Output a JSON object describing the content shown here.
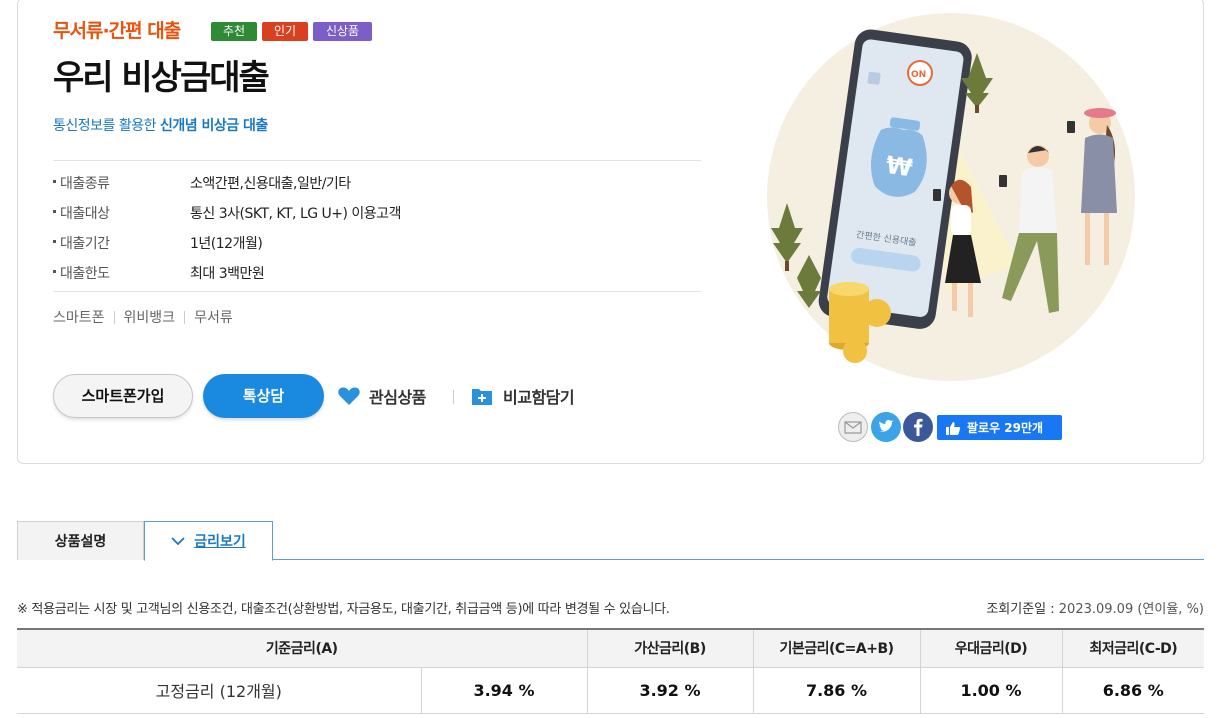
{
  "product": {
    "category": "무서류·간편 대출",
    "badges": [
      "추천",
      "인기",
      "신상품"
    ],
    "title": "우리 비상금대출",
    "subtitle_plain": "통신정보를 활용한 ",
    "subtitle_bold": "신개념 비상금 대출",
    "specs": [
      {
        "label": "대출종류",
        "value": "소액간편,신용대출,일반/기타"
      },
      {
        "label": "대출대상",
        "value": "통신 3사(SKT, KT, LG U+) 이용고객"
      },
      {
        "label": "대출기간",
        "value": "1년(12개월)"
      },
      {
        "label": "대출한도",
        "value": "최대 3백만원"
      }
    ],
    "tags": [
      "스마트폰",
      "위비뱅크",
      "무서류"
    ]
  },
  "actions": {
    "smartphone_join": "스마트폰가입",
    "talk": "톡상담",
    "interest": "관심상품",
    "compare": "비교함담기"
  },
  "illustration": {
    "phone_on_label": "ON",
    "phone_text": "간편한 신용대출"
  },
  "social": {
    "follow_label": "팔로우 29만개"
  },
  "tabs": {
    "description": "상품설명",
    "rates": "금리보기"
  },
  "rates": {
    "note": "※ 적용금리는 시장 및 고객님의 신용조건, 대출조건(상환방법, 자금용도, 대출기간, 취급금액 등)에 따라 변경될 수 있습니다.",
    "base_date_label": "조회기준일 : ",
    "base_date_value": "2023.09.09 (연이율, %)",
    "headers": [
      "기준금리(A)",
      "가산금리(B)",
      "기본금리(C=A+B)",
      "우대금리(D)",
      "최저금리(C-D)"
    ],
    "row": {
      "label": "고정금리 (12개월)",
      "base": "3.94 %",
      "add": "3.92 %",
      "basic": "7.86 %",
      "pref": "1.00 %",
      "min": "6.86 %"
    }
  },
  "colors": {
    "accent_orange": "#e8530e",
    "accent_blue": "#1a79c2",
    "button_blue": "#1a8ae0",
    "badge_green": "#2f8a36",
    "badge_red": "#d8401f",
    "badge_purple": "#7d5dc8"
  }
}
